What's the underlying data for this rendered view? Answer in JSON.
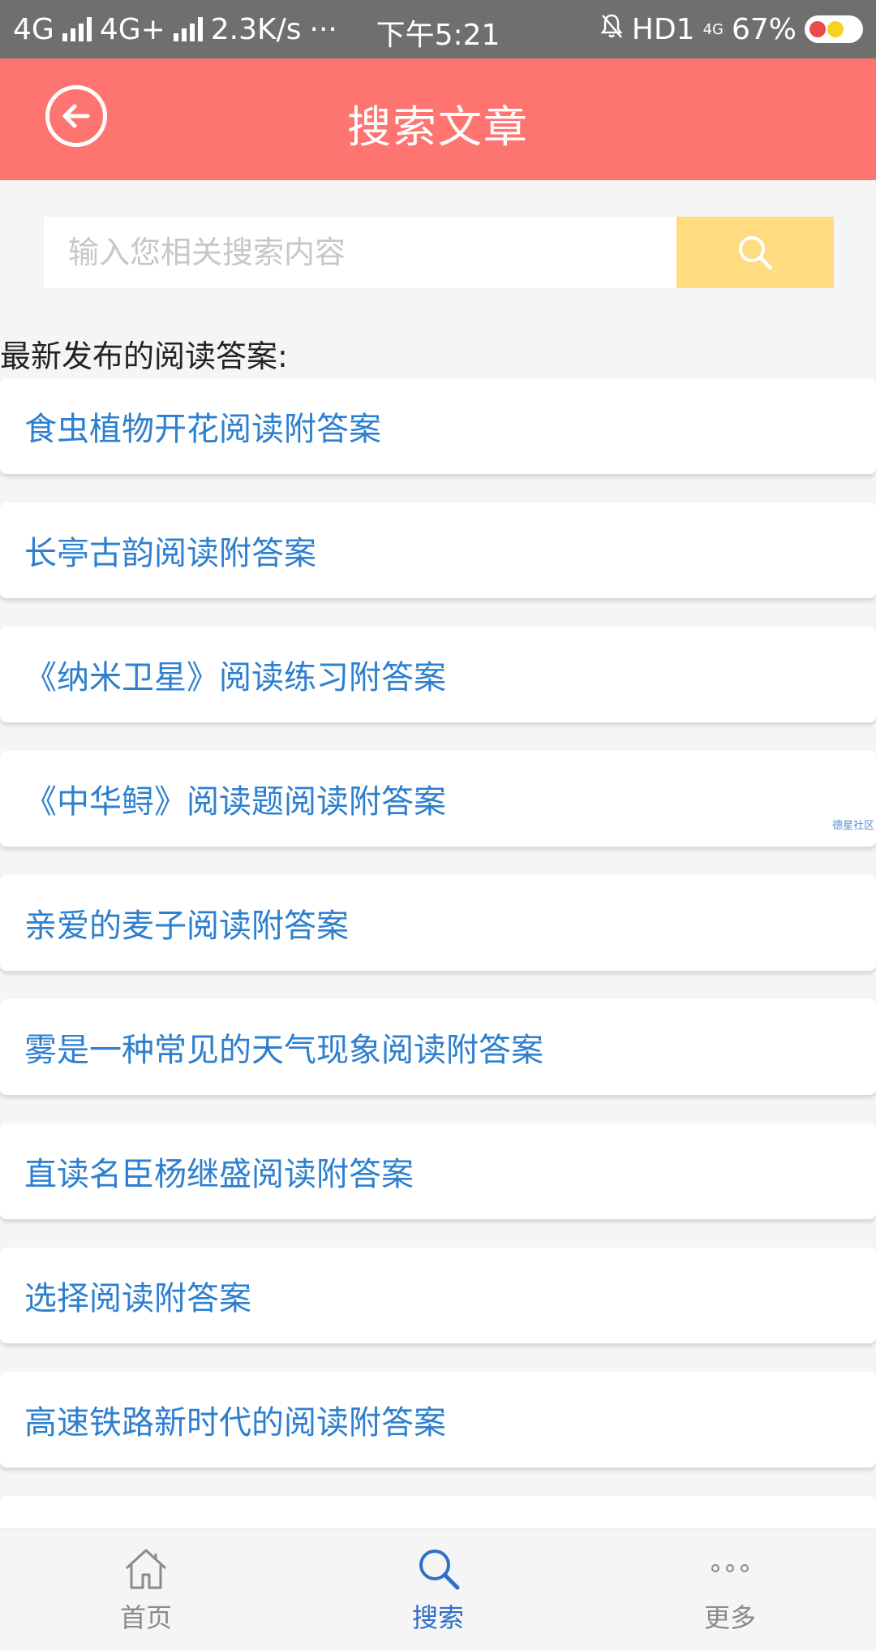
{
  "status_bar": {
    "network1": "4G",
    "network2": "4G+",
    "speed": "2.3K/s",
    "dots": "···",
    "time": "下午5:21",
    "hd": "HD1",
    "small_4g": "4G",
    "battery": "67%"
  },
  "header": {
    "title": "搜索文章"
  },
  "search": {
    "placeholder": "输入您相关搜索内容"
  },
  "section": {
    "label": "最新发布的阅读答案:"
  },
  "articles": [
    "食虫植物开花阅读附答案",
    "长亭古韵阅读附答案",
    "《纳米卫星》阅读练习附答案",
    "《中华鲟》阅读题阅读附答案",
    "亲爱的麦子阅读附答案",
    "雾是一种常见的天气现象阅读附答案",
    "直读名臣杨继盛阅读附答案",
    "选择阅读附答案",
    "高速铁路新时代的阅读附答案"
  ],
  "watermark": "德星社区",
  "nav": {
    "home": "首页",
    "search": "搜索",
    "more": "更多"
  },
  "colors": {
    "header": "#fd7470",
    "search_button": "#fedc7f",
    "link": "#2d7fcf",
    "nav_active": "#2f6fc8"
  }
}
